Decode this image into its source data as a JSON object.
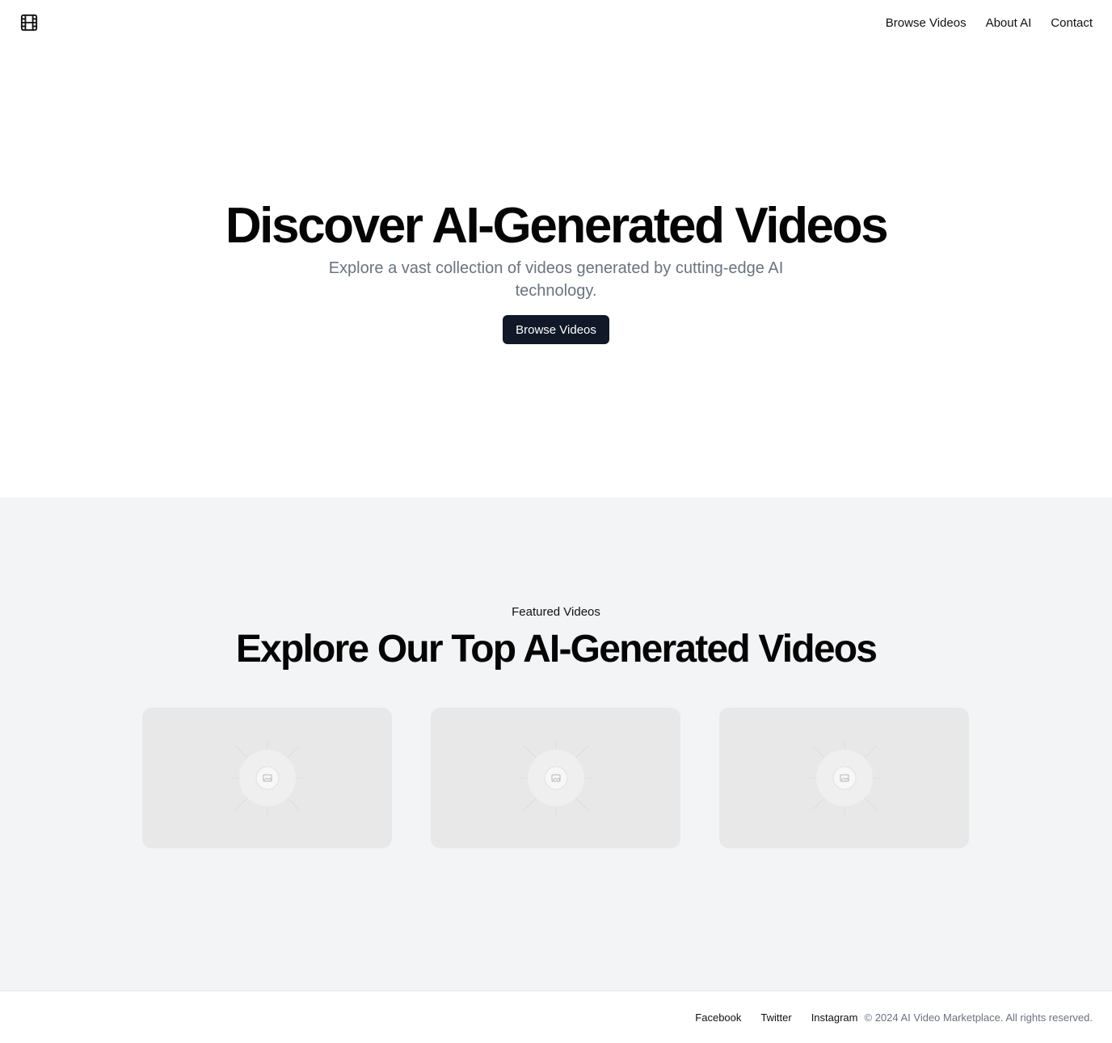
{
  "header": {
    "logo_icon": "film-icon",
    "nav": [
      "Browse Videos",
      "About AI",
      "Contact"
    ]
  },
  "hero": {
    "title": "Discover AI-Generated Videos",
    "subtitle": "Explore a vast collection of videos generated by cutting-edge AI technology.",
    "cta_label": "Browse Videos"
  },
  "featured": {
    "eyebrow": "Featured Videos",
    "title": "Explore Our Top AI-Generated Videos",
    "cards": [
      {
        "icon": "image-placeholder-icon"
      },
      {
        "icon": "image-placeholder-icon"
      },
      {
        "icon": "image-placeholder-icon"
      }
    ]
  },
  "footer": {
    "links": [
      "Facebook",
      "Twitter",
      "Instagram"
    ],
    "copyright": "© 2024 AI Video Marketplace. All rights reserved."
  },
  "colors": {
    "primary_button": "#111827",
    "muted_text": "#6b7280",
    "section_bg": "#f3f4f6",
    "card_bg": "#e8e8e8"
  }
}
